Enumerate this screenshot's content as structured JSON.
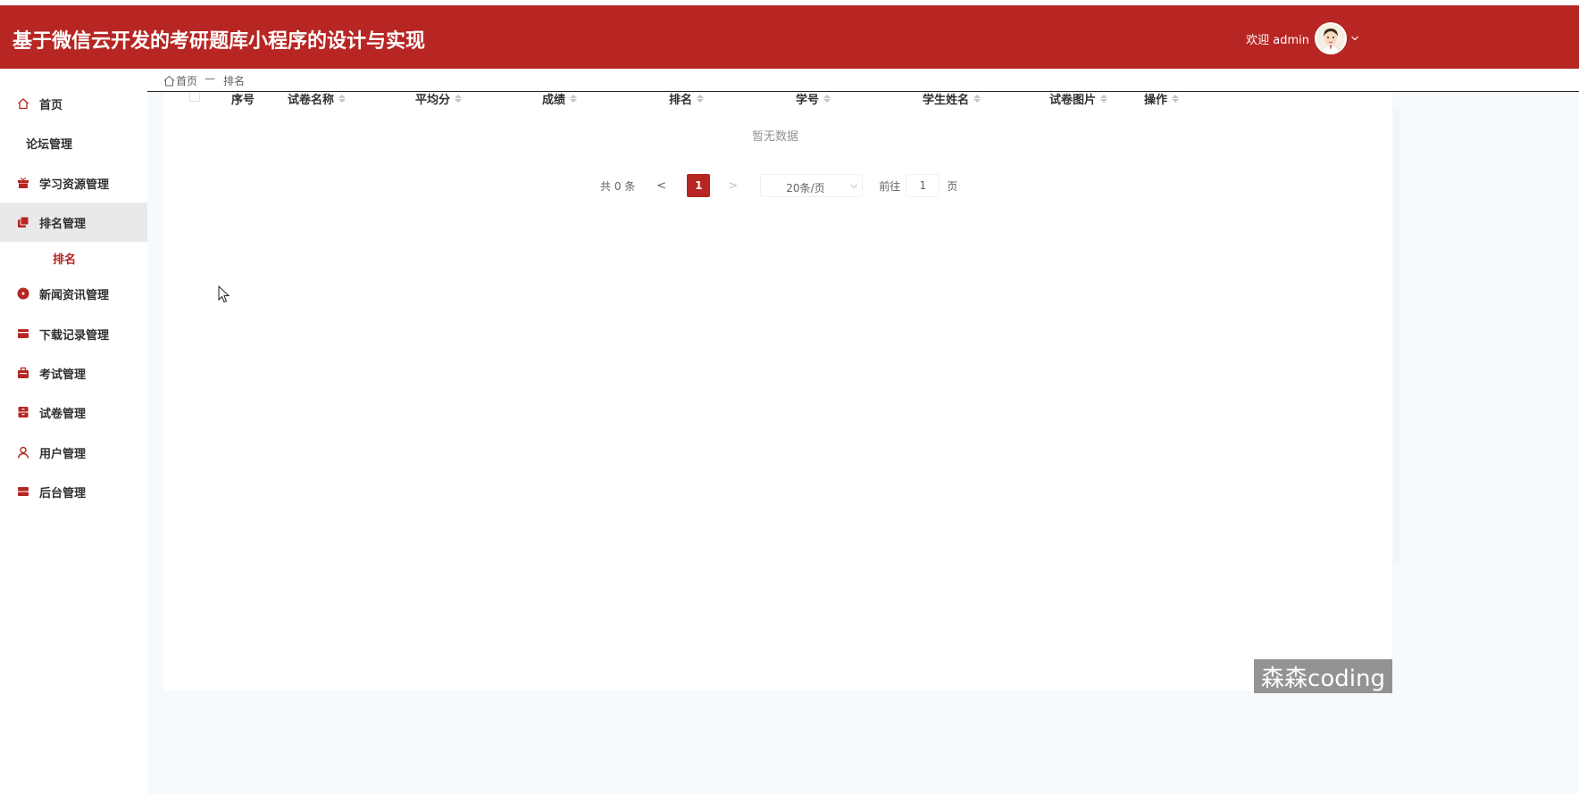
{
  "header": {
    "title": "基于微信云开发的考研题库小程序的设计与实现",
    "welcome": "欢迎 admin",
    "brand_color": "#b72623"
  },
  "breadcrumb": {
    "home": "首页",
    "separator": "—",
    "current": "排名"
  },
  "sidebar": {
    "items": [
      {
        "label": "首页",
        "icon": "home-icon"
      },
      {
        "label": "论坛管理",
        "icon": ""
      },
      {
        "label": "学习资源管理",
        "icon": "gift-icon"
      },
      {
        "label": "排名管理",
        "icon": "folders-icon",
        "active": true
      },
      {
        "label": "新闻资讯管理",
        "icon": "record-icon"
      },
      {
        "label": "下载记录管理",
        "icon": "wallet-icon"
      },
      {
        "label": "考试管理",
        "icon": "briefcase-icon"
      },
      {
        "label": "试卷管理",
        "icon": "cabinet-icon"
      },
      {
        "label": "用户管理",
        "icon": "user-icon"
      },
      {
        "label": "后台管理",
        "icon": "storage-icon"
      }
    ],
    "sub_items": [
      {
        "label": "排名"
      }
    ]
  },
  "table": {
    "columns": [
      "序号",
      "试卷名称",
      "平均分",
      "成绩",
      "排名",
      "学号",
      "学生姓名",
      "试卷图片",
      "操作"
    ],
    "rows": [],
    "empty_text": "暂无数据"
  },
  "pagination": {
    "total": "共 0 条",
    "prev": "<",
    "current_page": "1",
    "next": ">",
    "page_size": "20条/页",
    "goto_label": "前往",
    "goto_value": "1",
    "page_unit": "页"
  },
  "watermark": "森森coding"
}
